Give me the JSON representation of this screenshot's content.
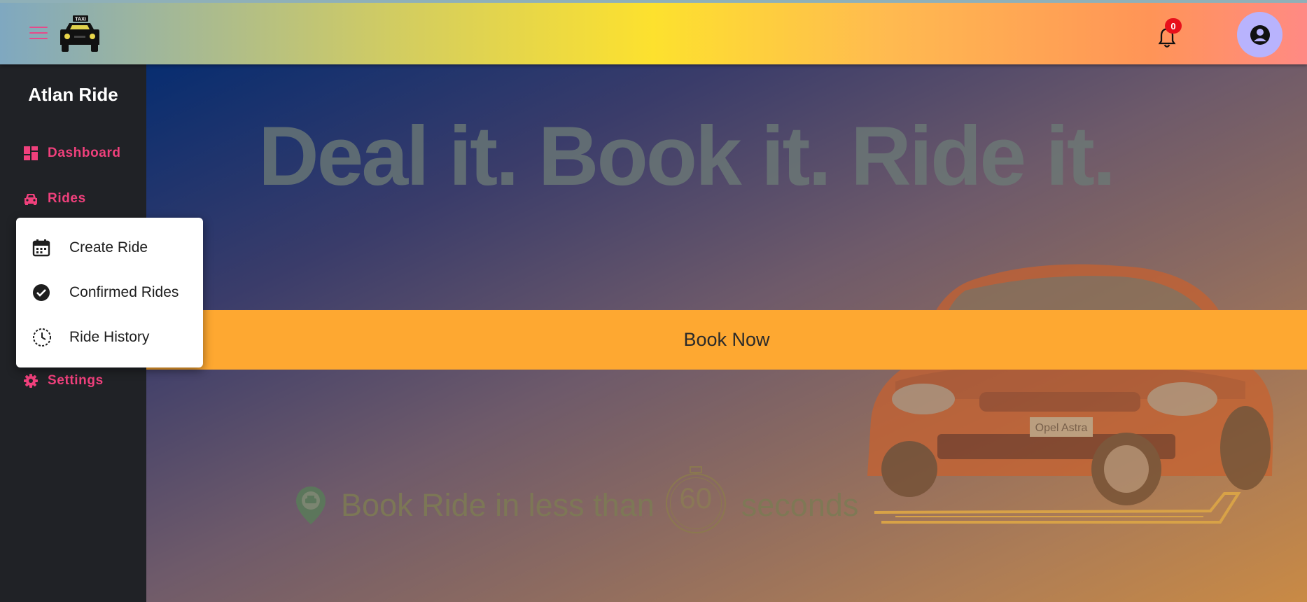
{
  "header": {
    "menu_icon": "hamburger-menu-icon",
    "logo_icon": "taxi-icon",
    "logo_text": "TAXI",
    "notification_icon": "bell-icon",
    "notification_count": "0",
    "profile_icon": "user-circle-icon"
  },
  "sidebar": {
    "brand": "Atlan Ride",
    "items": [
      {
        "label": "Dashboard",
        "icon": "dashboard-icon"
      },
      {
        "label": "Rides",
        "icon": "car-icon"
      },
      {
        "label": "Settings",
        "icon": "gear-icon"
      }
    ]
  },
  "rides_menu": {
    "items": [
      {
        "label": "Create Ride",
        "icon": "calendar-icon"
      },
      {
        "label": "Confirmed Rides",
        "icon": "check-circle-icon"
      },
      {
        "label": "Ride History",
        "icon": "history-clock-icon"
      }
    ]
  },
  "hero": {
    "headline": "Deal it. Book it. Ride it.",
    "book_button": "Book Now",
    "tagline_before": "Book Ride in less than",
    "tagline_number": "60",
    "tagline_after": "seconds",
    "car_plate": "Opel Astra"
  },
  "colors": {
    "accent_pink": "#f0407c",
    "book_button": "#fea831",
    "sidebar_bg": "#202226",
    "badge_red": "#e8101b",
    "avatar_bg": "#b8b3fd"
  }
}
